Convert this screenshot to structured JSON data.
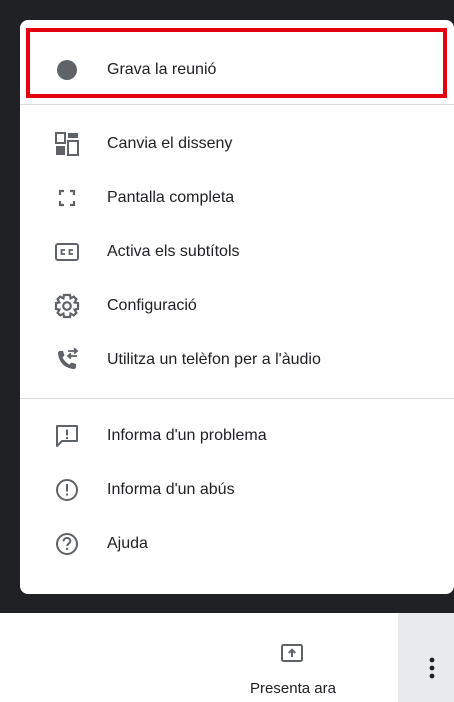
{
  "menu": {
    "items": [
      {
        "label": "Grava la reunió",
        "icon": "record-icon"
      },
      {
        "label": "Canvia el disseny",
        "icon": "layout-icon"
      },
      {
        "label": "Pantalla completa",
        "icon": "fullscreen-icon"
      },
      {
        "label": "Activa els subtítols",
        "icon": "closed-captions-icon"
      },
      {
        "label": "Configuració",
        "icon": "settings-gear-icon"
      },
      {
        "label": "Utilitza un telèfon per a l'àudio",
        "icon": "phone-forward-icon"
      },
      {
        "label": "Informa d'un problema",
        "icon": "report-problem-icon"
      },
      {
        "label": "Informa d'un abús",
        "icon": "report-abuse-icon"
      },
      {
        "label": "Ajuda",
        "icon": "help-icon"
      }
    ]
  },
  "bottom_bar": {
    "present_label": "Presenta ara",
    "present_icon": "present-screen-icon",
    "more_icon": "more-vert-icon"
  },
  "colors": {
    "highlight": "#e3000f",
    "icon": "#5f6368",
    "text": "#202124",
    "backdrop": "#202124"
  }
}
